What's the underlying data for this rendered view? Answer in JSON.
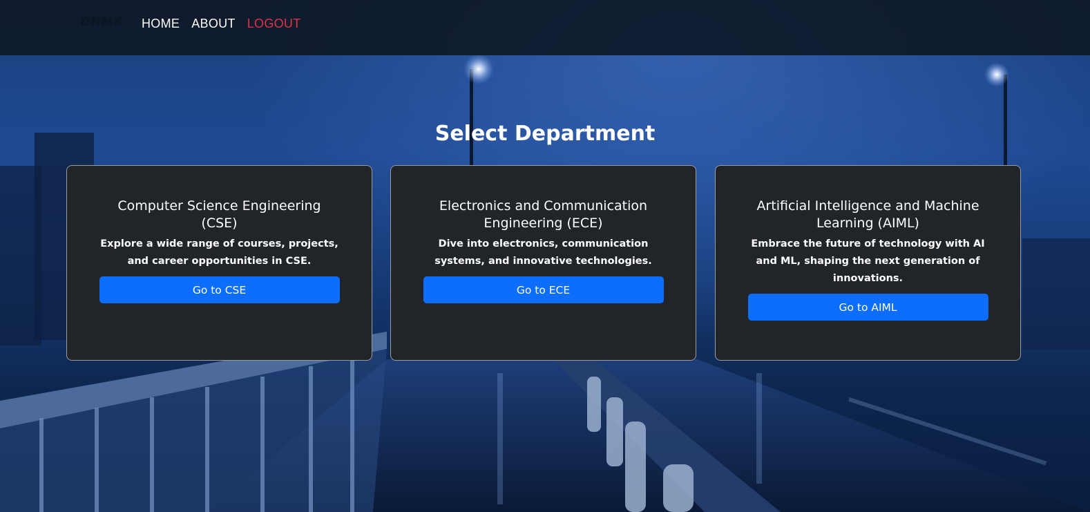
{
  "nav": {
    "brand": "DNMX",
    "links": [
      {
        "label": "HOME"
      },
      {
        "label": "ABOUT"
      },
      {
        "label": "LOGOUT"
      }
    ]
  },
  "main": {
    "heading": "Select Department",
    "cards": [
      {
        "title": "Computer Science Engineering (CSE)",
        "text": "Explore a wide range of courses, projects, and career opportunities in CSE.",
        "button": "Go to CSE"
      },
      {
        "title": "Electronics and Communication Engineering (ECE)",
        "text": "Dive into electronics, communication systems, and innovative technologies.",
        "button": "Go to ECE"
      },
      {
        "title": "Artificial Intelligence and Machine Learning (AIML)",
        "text": "Embrace the future of technology with AI and ML, shaping the next generation of innovations.",
        "button": "Go to AIML"
      }
    ]
  },
  "colors": {
    "primary": "#0d6efd",
    "card_bg": "#212529",
    "logout": "#dc3545",
    "navbar": "#0e1622"
  }
}
